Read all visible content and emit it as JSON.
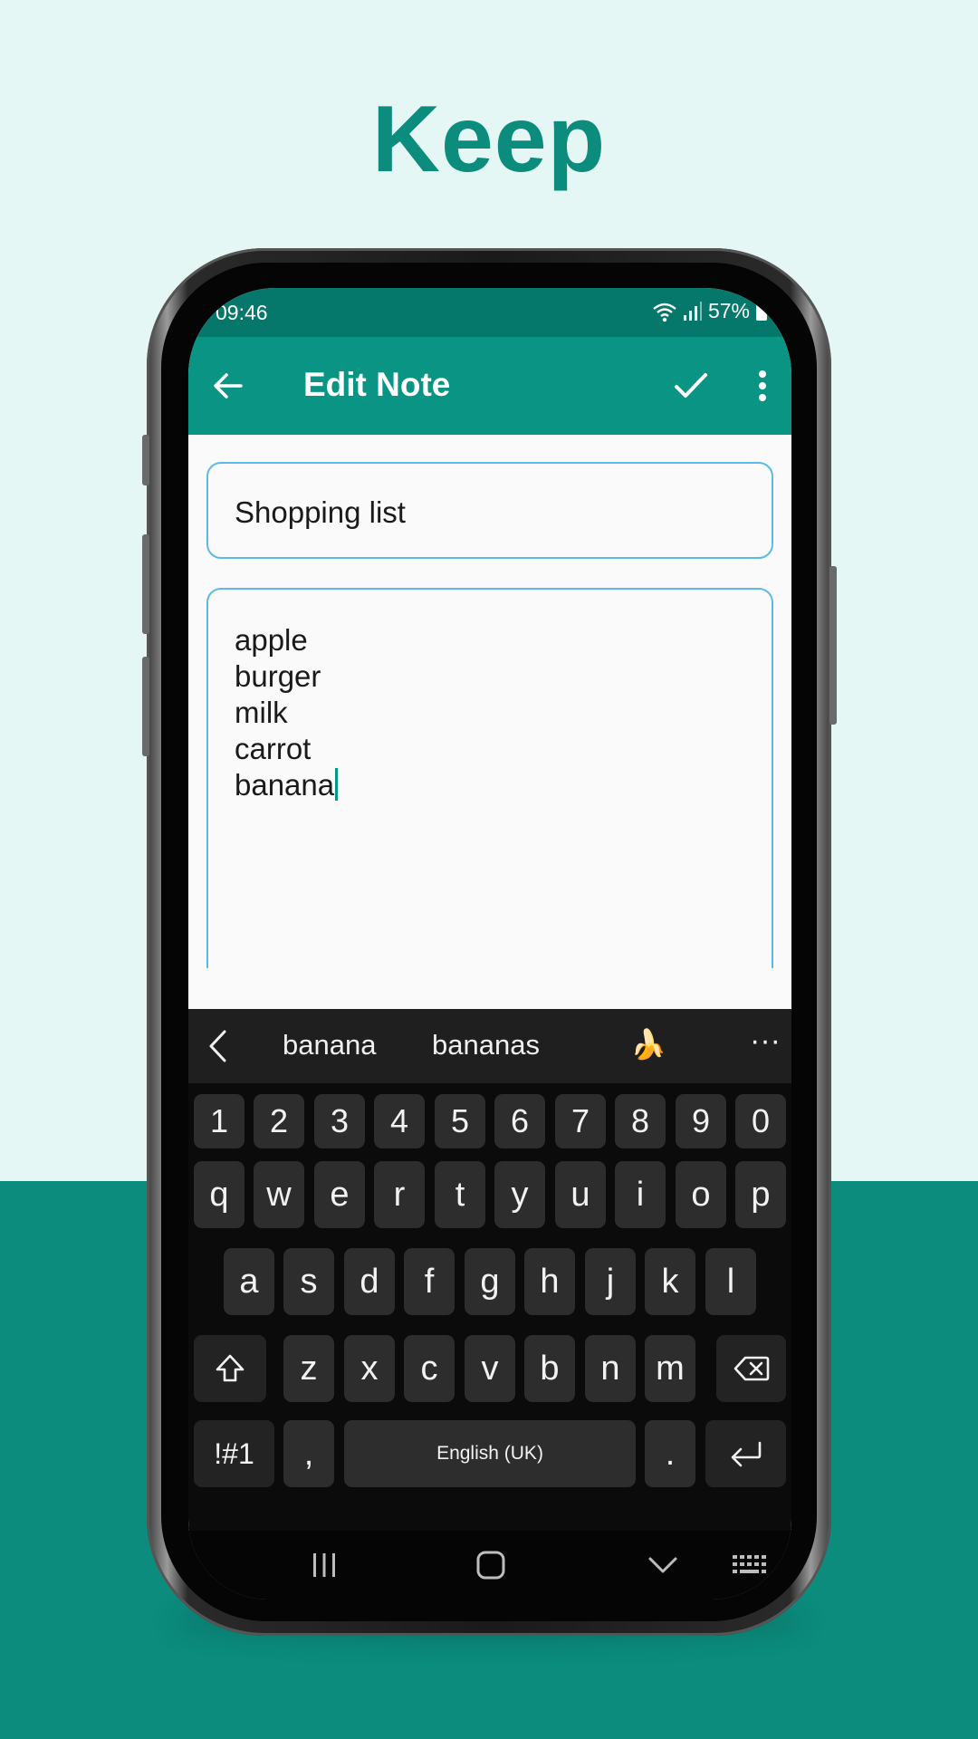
{
  "headline": "Keep",
  "status": {
    "time": "09:46",
    "battery": "57%"
  },
  "appbar": {
    "title": "Edit Note"
  },
  "note": {
    "title": "Shopping list",
    "lines": [
      "apple",
      "burger",
      "milk",
      "carrot",
      "banana"
    ]
  },
  "suggestions": {
    "first": "banana",
    "second": "bananas",
    "emoji": "🍌",
    "more": "···"
  },
  "keyboard": {
    "numbers": [
      "1",
      "2",
      "3",
      "4",
      "5",
      "6",
      "7",
      "8",
      "9",
      "0"
    ],
    "row1": [
      "q",
      "w",
      "e",
      "r",
      "t",
      "y",
      "u",
      "i",
      "o",
      "p"
    ],
    "row2": [
      "a",
      "s",
      "d",
      "f",
      "g",
      "h",
      "j",
      "k",
      "l"
    ],
    "row3": [
      "z",
      "x",
      "c",
      "v",
      "b",
      "n",
      "m"
    ],
    "symbols": "!#1",
    "comma": ",",
    "space": "English (UK)",
    "period": "."
  },
  "colors": {
    "accent": "#0a9484",
    "status_bar": "#06786b",
    "background": "#e4f7f5",
    "field_border": "#5bbbe6"
  },
  "icons": {
    "back": "arrow-left-icon",
    "save": "check-icon",
    "menu": "more-vert-icon"
  }
}
